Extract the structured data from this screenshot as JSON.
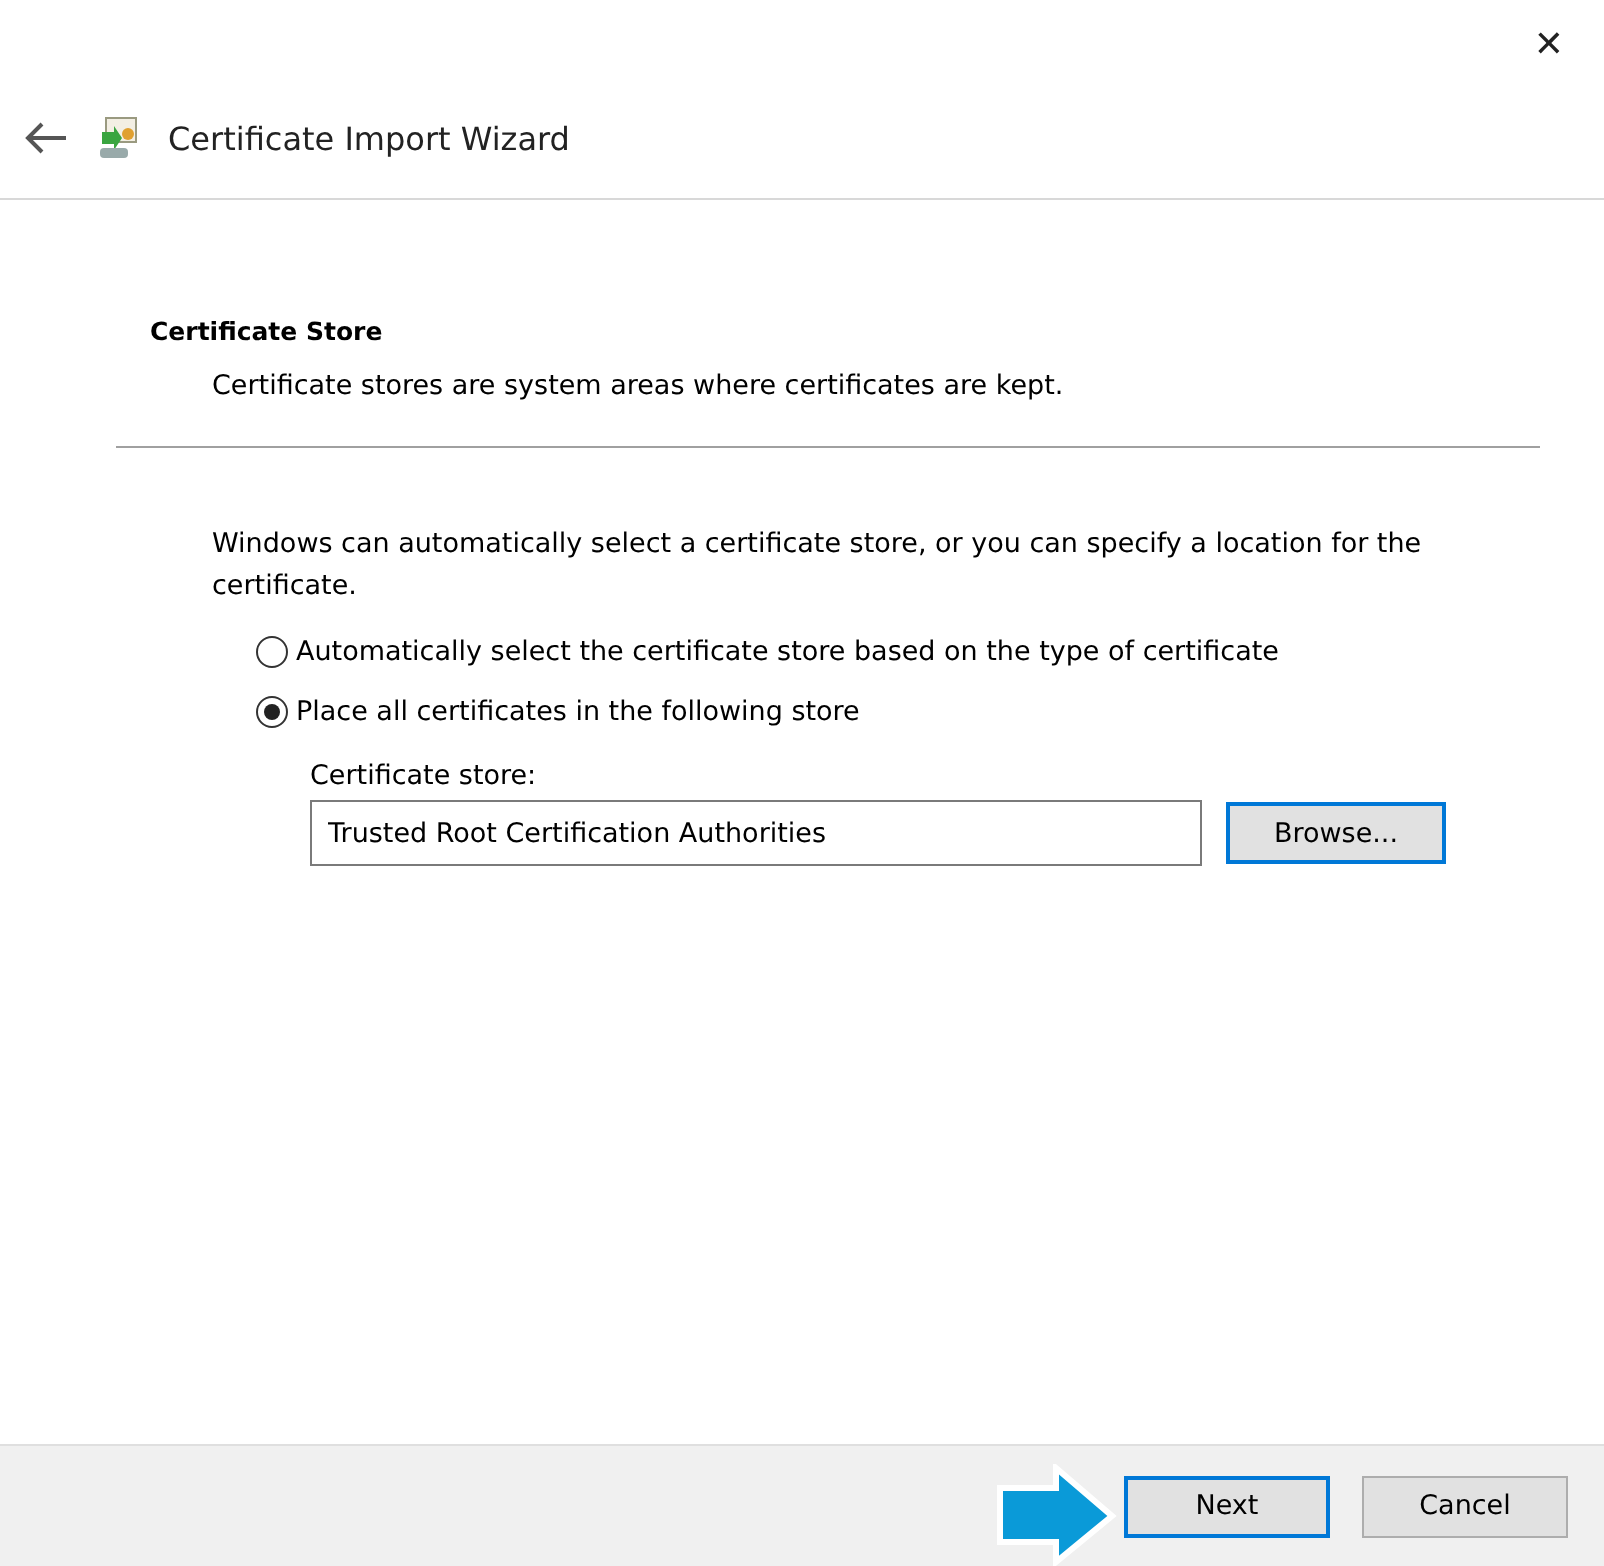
{
  "window": {
    "title": "Certificate Import Wizard",
    "close": "✕"
  },
  "section": {
    "title": "Certificate Store",
    "subtitle": "Certificate stores are system areas where certificates are kept."
  },
  "intro": "Windows can automatically select a certificate store, or you can specify a location for the certificate.",
  "options": [
    {
      "label": "Automatically select the certificate store based on the type of certificate",
      "selected": false
    },
    {
      "label": "Place all certificates in the following store",
      "selected": true
    }
  ],
  "store": {
    "label": "Certificate store:",
    "value": "Trusted Root Certification Authorities",
    "browse": "Browse..."
  },
  "buttons": [
    {
      "label": "Next",
      "focused": true
    },
    {
      "label": "Cancel",
      "focused": false
    }
  ]
}
